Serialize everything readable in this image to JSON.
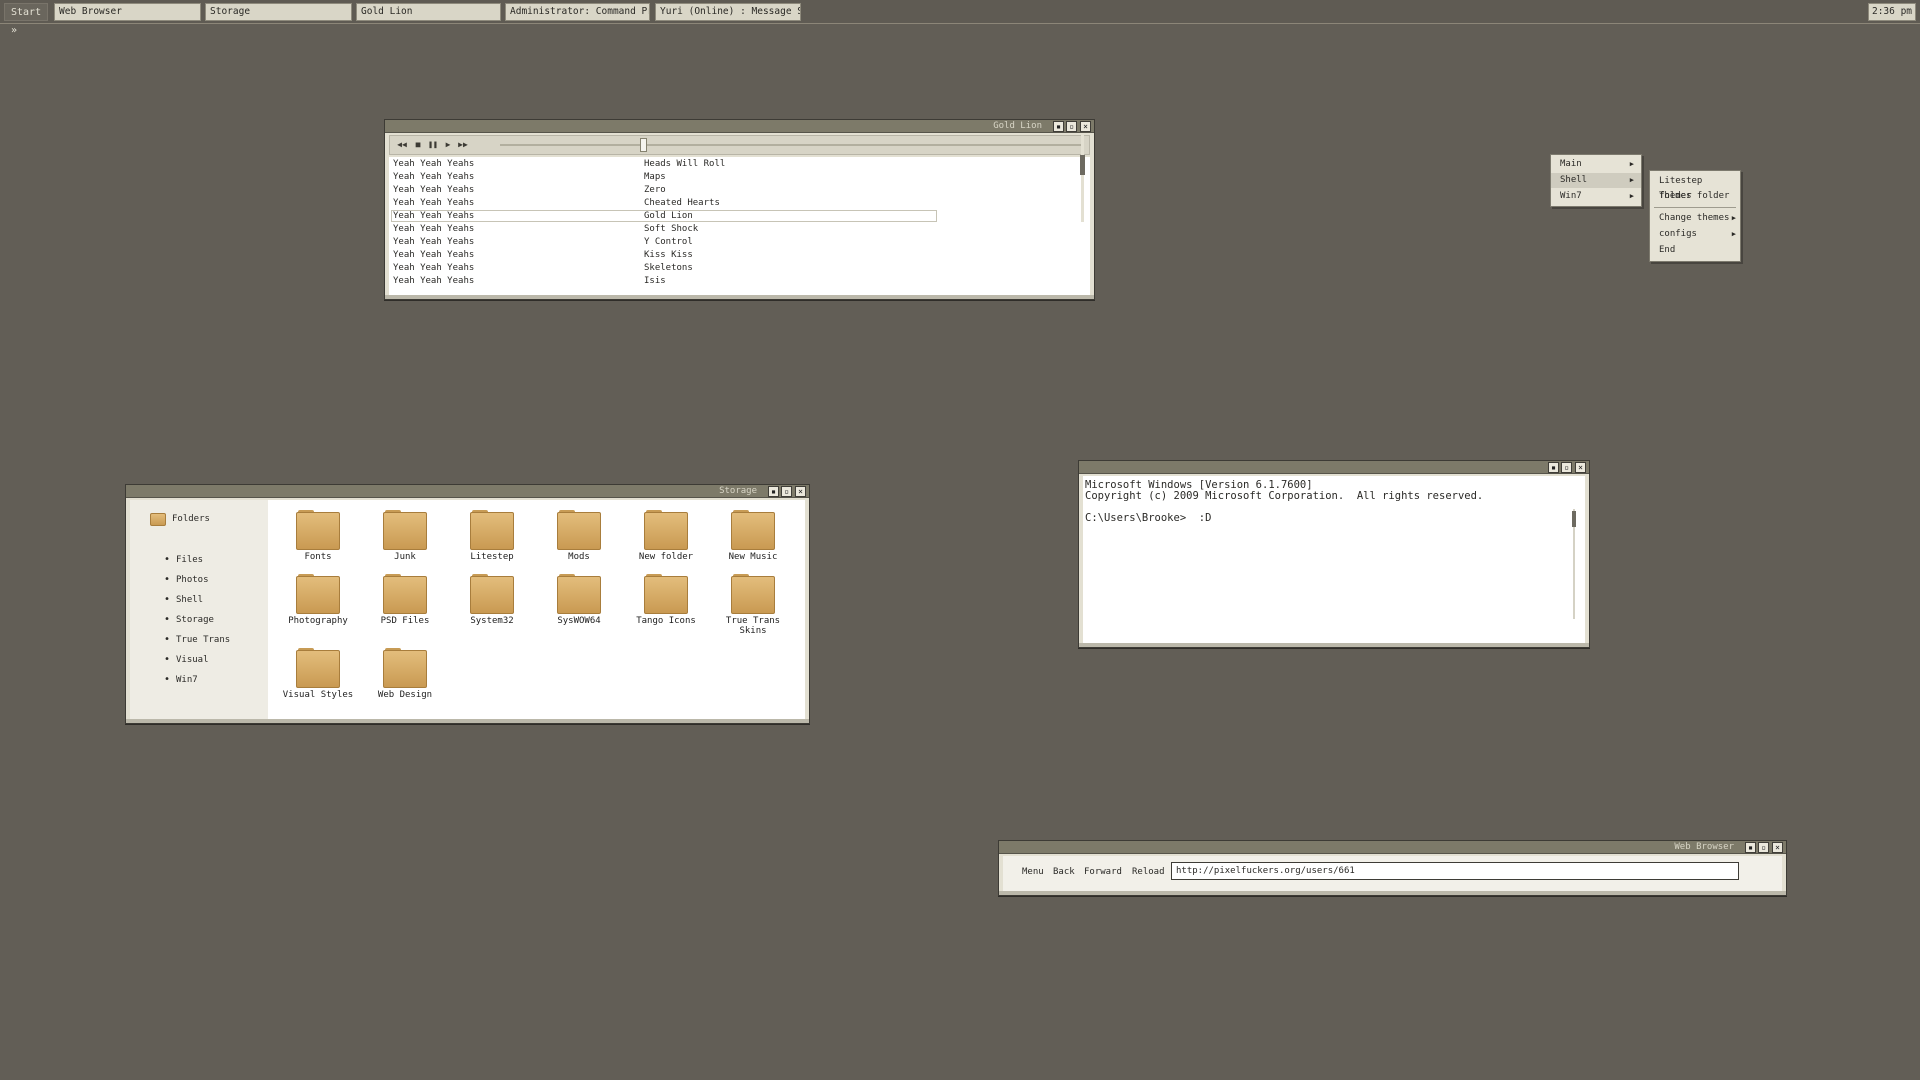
{
  "taskbar": {
    "start_label": "Start »",
    "buttons": [
      "Web Browser",
      "Storage",
      "Gold Lion",
      "Administrator: Command Prom...",
      "Yuri (Online) : Message Sessi..."
    ],
    "clock": "2:36 pm"
  },
  "player": {
    "title": "Gold Lion",
    "seek_position_fraction": 0.24,
    "tracks": [
      {
        "artist": "Yeah Yeah Yeahs",
        "title": "Heads Will Roll"
      },
      {
        "artist": "Yeah Yeah Yeahs",
        "title": "Maps"
      },
      {
        "artist": "Yeah Yeah Yeahs",
        "title": "Zero"
      },
      {
        "artist": "Yeah Yeah Yeahs",
        "title": "Cheated Hearts"
      },
      {
        "artist": "Yeah Yeah Yeahs",
        "title": "Gold Lion"
      },
      {
        "artist": "Yeah Yeah Yeahs",
        "title": "Soft Shock"
      },
      {
        "artist": "Yeah Yeah Yeahs",
        "title": "Y Control"
      },
      {
        "artist": "Yeah Yeah Yeahs",
        "title": "Kiss Kiss"
      },
      {
        "artist": "Yeah Yeah Yeahs",
        "title": "Skeletons"
      },
      {
        "artist": "Yeah Yeah Yeahs",
        "title": "Isis"
      }
    ]
  },
  "storage": {
    "title": "Storage",
    "sidebar_header": "Folders",
    "sidebar_items": [
      "Files",
      "Photos",
      "Shell",
      "Storage",
      "True Trans",
      "Visual",
      "Win7"
    ],
    "folders": [
      "Fonts",
      "Junk",
      "Litestep",
      "Mods",
      "New folder",
      "New Music",
      "Photography",
      "PSD Files",
      "System32",
      "SysWOW64",
      "Tango Icons",
      "True Trans Skins",
      "Visual Styles",
      "Web Design"
    ]
  },
  "cmd": {
    "line1": "Microsoft Windows [Version 6.1.7600]",
    "line2": "Copyright (c) 2009 Microsoft Corporation.  All rights reserved.",
    "line3": "",
    "line4": "C:\\Users\\Brooke>  :D"
  },
  "menu": {
    "main": [
      "Main",
      "Shell",
      "Win7"
    ],
    "sub": [
      "Litestep folder",
      "Themes folder",
      "Change themes",
      "configs",
      "End"
    ]
  },
  "browser": {
    "title": "Web Browser",
    "menu_label": "Menu",
    "back_label": "Back",
    "forward_label": "Forward",
    "reload_label": "Reload",
    "url": "http://pixelfuckers.org/users/661"
  }
}
